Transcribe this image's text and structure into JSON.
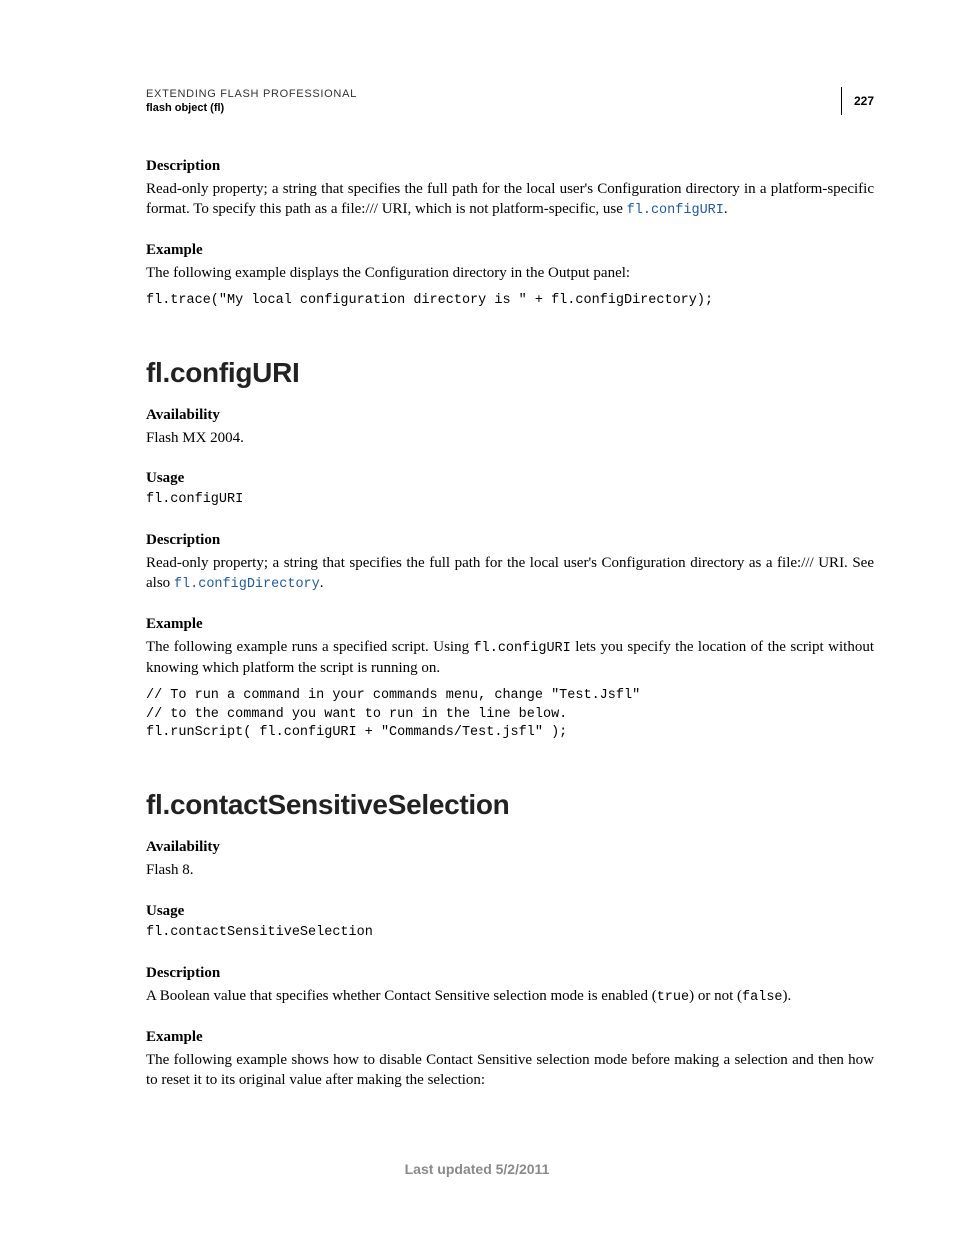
{
  "header": {
    "running": "EXTENDING FLASH PROFESSIONAL",
    "sub": "flash object (fl)",
    "page_number": "227"
  },
  "section0": {
    "desc_h": "Description",
    "desc_t1": "Read-only property; a string that specifies the full path for the local user's Configuration directory in a platform-specific format. To specify this path as a file:/// URI, which is not platform-specific, use ",
    "desc_link": "fl.configURI",
    "desc_t2": ".",
    "ex_h": "Example",
    "ex_t": "The following example displays the Configuration directory in the Output panel:",
    "code": "fl.trace(\"My local configuration directory is \" + fl.configDirectory);"
  },
  "section1": {
    "title": "fl.configURI",
    "avail_h": "Availability",
    "avail_t": "Flash MX 2004.",
    "usage_h": "Usage",
    "usage_code": "fl.configURI",
    "desc_h": "Description",
    "desc_t1": "Read-only property; a string that specifies the full path for the local user's Configuration directory as a file:/// URI. See also ",
    "desc_link": "fl.configDirectory",
    "desc_t2": ".",
    "ex_h": "Example",
    "ex_t1": "The following example runs a specified script. Using ",
    "ex_code_inline": "fl.configURI",
    "ex_t2": " lets you specify the location of the script without knowing which platform the script is running on.",
    "code": "// To run a command in your commands menu, change \"Test.Jsfl\" \n// to the command you want to run in the line below. \nfl.runScript( fl.configURI + \"Commands/Test.jsfl\" );"
  },
  "section2": {
    "title": "fl.contactSensitiveSelection",
    "avail_h": "Availability",
    "avail_t": "Flash 8.",
    "usage_h": "Usage",
    "usage_code": "fl.contactSensitiveSelection",
    "desc_h": "Description",
    "desc_t1": "A Boolean value that specifies whether Contact Sensitive selection mode is enabled (",
    "desc_c1": "true",
    "desc_t2": ") or not (",
    "desc_c2": "false",
    "desc_t3": ").",
    "ex_h": "Example",
    "ex_t": "The following example shows how to disable Contact Sensitive selection mode before making a selection and then how to reset it to its original value after making the selection:"
  },
  "footer": {
    "text": "Last updated 5/2/2011"
  }
}
